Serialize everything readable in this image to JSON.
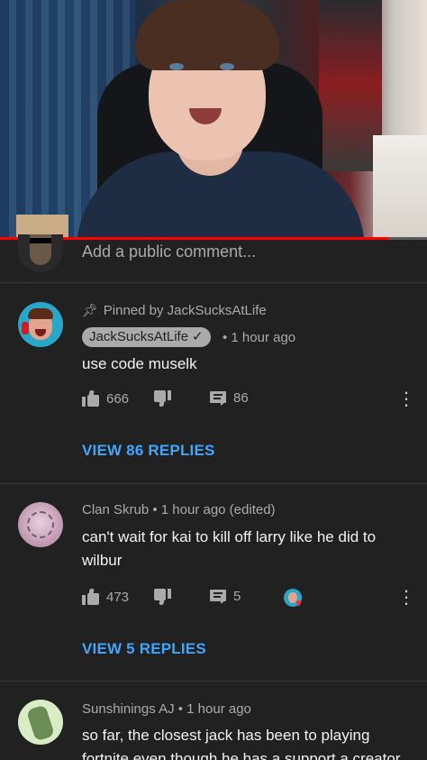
{
  "video": {
    "progress_fraction": 0.91
  },
  "add_comment": {
    "placeholder": "Add a public comment..."
  },
  "comments": [
    {
      "pinned_label": "Pinned by JackSucksAtLife",
      "author": "JackSucksAtLife",
      "author_verified": true,
      "time": "• 1 hour ago",
      "text": "use code muselk",
      "likes": "666",
      "replies_count": "86",
      "view_replies": "VIEW 86 REPLIES"
    },
    {
      "author_line": "Clan Skrub • 1 hour ago (edited)",
      "text": "can't wait for kai to kill off larry like he did to wilbur",
      "likes": "473",
      "replies_count": "5",
      "creator_heart": true,
      "view_replies": "VIEW 5 REPLIES"
    },
    {
      "author_line": "Sunshinings AJ • 1 hour ago",
      "text": "so far, the closest jack has been to playing fortnite even though he has a support a creator"
    }
  ],
  "icons": {
    "pin": "pin-icon",
    "check": "verified-check-icon",
    "like": "thumbs-up-icon",
    "dislike": "thumbs-down-icon",
    "reply": "reply-bubble-icon",
    "more": "more-vertical-icon",
    "heart": "creator-heart-icon"
  },
  "colors": {
    "background": "#212121",
    "link_blue": "#3ea6ff",
    "progress_red": "#ff0000",
    "muted_text": "#aaaaaa"
  }
}
